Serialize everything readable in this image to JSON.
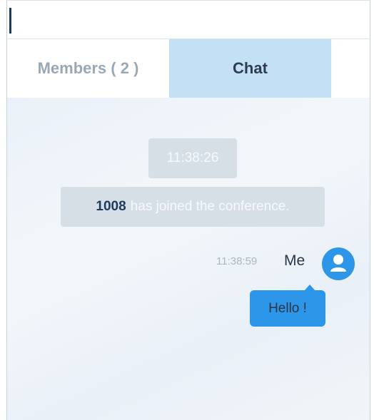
{
  "tabs": {
    "members_label": "Members ( 2 )",
    "chat_label": "Chat"
  },
  "chat": {
    "system_time": "11:38:26",
    "join_user": "1008",
    "join_text": "has joined the conference.",
    "message": {
      "time": "11:38:59",
      "sender": "Me",
      "text": "Hello !"
    }
  },
  "icons": {
    "menu": "hamburger-menu-icon",
    "avatar": "user-avatar-icon"
  },
  "colors": {
    "accent": "#2e96e8",
    "active_tab": "#c3e0f4",
    "system_pill": "#d6dee6",
    "chat_background": "#edf3f9"
  }
}
